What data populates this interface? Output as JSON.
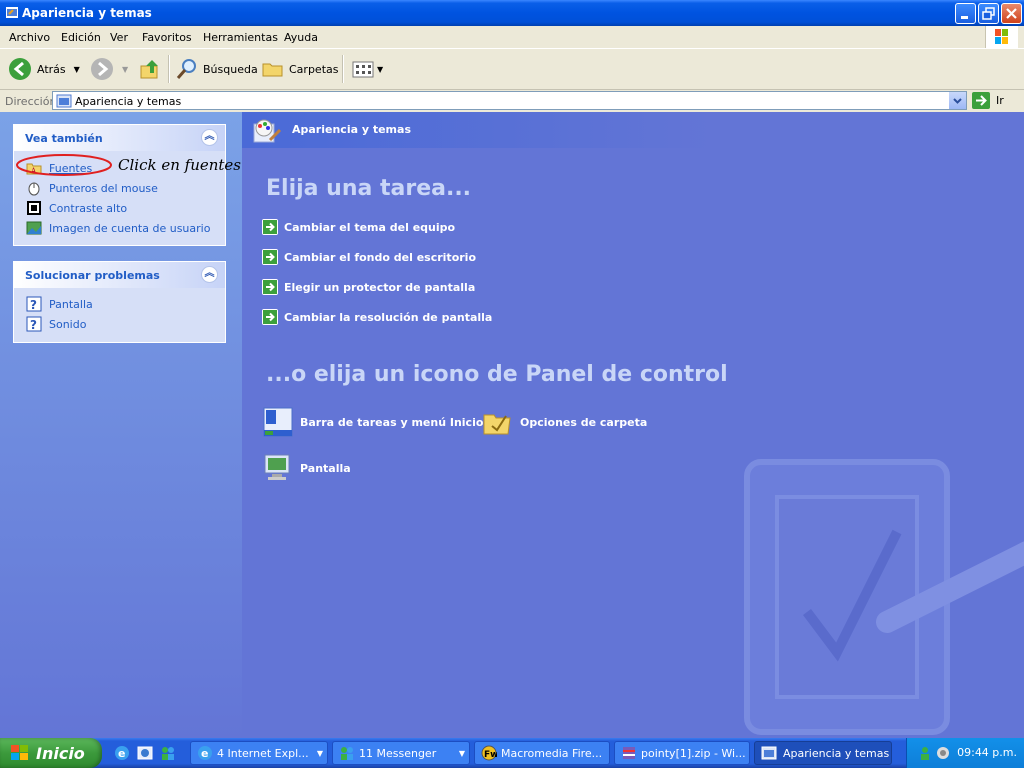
{
  "window": {
    "title": "Apariencia y temas",
    "buttons": [
      "minimize-button",
      "maximize-button",
      "close-button"
    ]
  },
  "menu": [
    "Archivo",
    "Edición",
    "Ver",
    "Favoritos",
    "Herramientas",
    "Ayuda"
  ],
  "toolbar": {
    "back_label": "Atrás",
    "search_label": "Búsqueda",
    "folders_label": "Carpetas"
  },
  "address": {
    "label": "Dirección",
    "value": "Apariencia y temas",
    "go_label": "Ir"
  },
  "sidebar": {
    "see_also": {
      "title": "Vea también",
      "items": [
        {
          "label": "Fuentes",
          "icon": "fonts-folder-icon"
        },
        {
          "label": "Punteros del mouse",
          "icon": "mouse-icon"
        },
        {
          "label": "Contraste alto",
          "icon": "contrast-icon"
        },
        {
          "label": "Imagen de cuenta de usuario",
          "icon": "user-picture-icon"
        }
      ],
      "annotation": "Click en fuentes"
    },
    "troubleshoot": {
      "title": "Solucionar problemas",
      "items": [
        {
          "label": "Pantalla",
          "icon": "help-icon"
        },
        {
          "label": "Sonido",
          "icon": "help-icon"
        }
      ]
    }
  },
  "main": {
    "breadcrumb": "Apariencia y temas",
    "task_heading": "Elija una tarea...",
    "tasks": [
      "Cambiar el tema del equipo",
      "Cambiar el fondo del escritorio",
      "Elegir un protector de pantalla",
      "Cambiar la resolución de pantalla"
    ],
    "icon_heading": "...o elija un icono de Panel de control",
    "icons": [
      {
        "label": "Barra de tareas y menú Inicio",
        "icon": "taskbar-icon"
      },
      {
        "label": "Opciones de carpeta",
        "icon": "folder-options-icon"
      },
      {
        "label": "Pantalla",
        "icon": "display-icon"
      }
    ]
  },
  "taskbar": {
    "start_label": "Inicio",
    "buttons": [
      "4 Internet Expl...",
      "11 Messenger",
      "Macromedia Fire...",
      "pointy[1].zip - Wi...",
      "Apariencia y temas"
    ],
    "clock": "09:44 p.m."
  },
  "colors": {
    "titlebar": "#0053e0",
    "pane_blue": "#6375d6",
    "link_blue": "#215dc6",
    "heading_light": "#c9d6f7",
    "annotation_red": "#e02020"
  }
}
